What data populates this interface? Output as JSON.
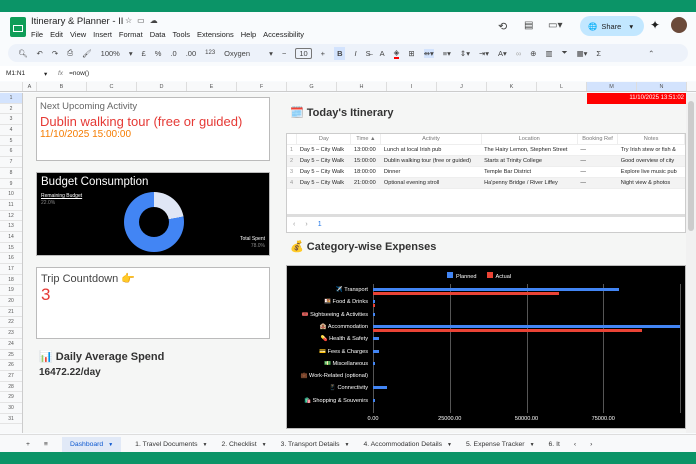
{
  "app": {
    "title": "Itinerary & Planner - II",
    "menu": [
      "File",
      "Edit",
      "View",
      "Insert",
      "Format",
      "Data",
      "Tools",
      "Extensions",
      "Help",
      "Accessibility"
    ],
    "share": "Share"
  },
  "toolbar": {
    "zoom": "100%",
    "currency": "£",
    "percent": "%",
    "dec_less": ".0",
    "dec_more": ".00",
    "format_123": "123",
    "font": "Oxygen",
    "font_size": "10",
    "bold": "B",
    "italic": "I",
    "sum": "Σ"
  },
  "formula": {
    "cell_ref": "M1:N1",
    "fx": "fx",
    "value": "=now()"
  },
  "columns": [
    "A",
    "B",
    "C",
    "D",
    "E",
    "F",
    "G",
    "H",
    "I",
    "J",
    "K",
    "L",
    "M",
    "N"
  ],
  "rows": [
    "1",
    "2",
    "3",
    "4",
    "5",
    "6",
    "7",
    "8",
    "9",
    "10",
    "11",
    "12",
    "13",
    "14",
    "15",
    "16",
    "17",
    "18",
    "19",
    "20",
    "21",
    "22",
    "23",
    "24",
    "25",
    "26",
    "27",
    "28",
    "29",
    "30",
    "31"
  ],
  "now_cell": "11/10/2025 13:51:02",
  "next_activity": {
    "label": "Next Upcoming Activity",
    "name": "Dublin walking tour (free or guided)",
    "datetime": "11/10/2025 15:00:00"
  },
  "budget": {
    "title": "Budget Consumption",
    "remaining_label": "Remaining Budget",
    "remaining_pct": "22.0%",
    "spent_label": "Total Spent",
    "spent_pct": "78.0%",
    "remaining": 22.0,
    "spent": 78.0
  },
  "countdown": {
    "label": "Trip Countdown 👉",
    "value": "3"
  },
  "daily": {
    "title": "📊 Daily Average Spend",
    "value": "16472.22/day"
  },
  "itinerary": {
    "title": "🗓️ Today's Itinerary",
    "headers": [
      "Day",
      "Time ▲",
      "Activity",
      "Location",
      "Booking Ref",
      "Notes"
    ],
    "rows": [
      [
        "1",
        "Day 5 – City Walk",
        "13:00:00",
        "Lunch at local Irish pub",
        "The Hairy Lemon, Stephen Street",
        "—",
        "Try Irish stew or fish &"
      ],
      [
        "2",
        "Day 5 – City Walk",
        "15:00:00",
        "Dublin walking tour (free or guided)",
        "Starts at Trinity College",
        "—",
        "Good overview of city"
      ],
      [
        "3",
        "Day 5 – City Walk",
        "18:00:00",
        "Dinner",
        "Temple Bar District",
        "—",
        "Explore live music pub"
      ],
      [
        "4",
        "Day 5 – City Walk",
        "21:00:00",
        "Optional evening stroll",
        "Ha'penny Bridge / River Liffey",
        "—",
        "Night view & photos"
      ]
    ],
    "page": "1",
    "prev": "‹",
    "next": "›"
  },
  "expenses_title": "💰 Category-wise Expenses",
  "chart_data": {
    "type": "bar",
    "orientation": "horizontal",
    "legend": [
      "Planned",
      "Actual"
    ],
    "legend_position": "top",
    "categories": [
      "✈️ Transport",
      "🍱 Food & Drinks",
      "🎟️ Sightseeing & Activities",
      "🏨 Accommodation",
      "💊 Health & Safety",
      "💳 Fees & Charges",
      "💵 Miscellaneous",
      "💼 Work-Related (optional)",
      "📱 Connectivity",
      "🛍️ Shopping & Souvenirs"
    ],
    "series": [
      {
        "name": "Planned",
        "color": "#4285f4",
        "values": [
          80000,
          600,
          600,
          100000,
          2000,
          2000,
          700,
          0,
          4500,
          600
        ]
      },
      {
        "name": "Actual",
        "color": "#ea4335",
        "values": [
          60500,
          800,
          0,
          87600,
          0,
          0,
          0,
          0,
          0,
          0
        ]
      }
    ],
    "xticks": [
      "0.00",
      "25000.00",
      "50000.00",
      "75000.00"
    ],
    "xlim": [
      0,
      100000
    ],
    "grid": true
  },
  "tabs": [
    "Dashboard",
    "1. Travel Documents",
    "2. Checklist",
    "3. Transport Details",
    "4. Accommodation Details",
    "5. Expense Tracker",
    "6. It"
  ]
}
